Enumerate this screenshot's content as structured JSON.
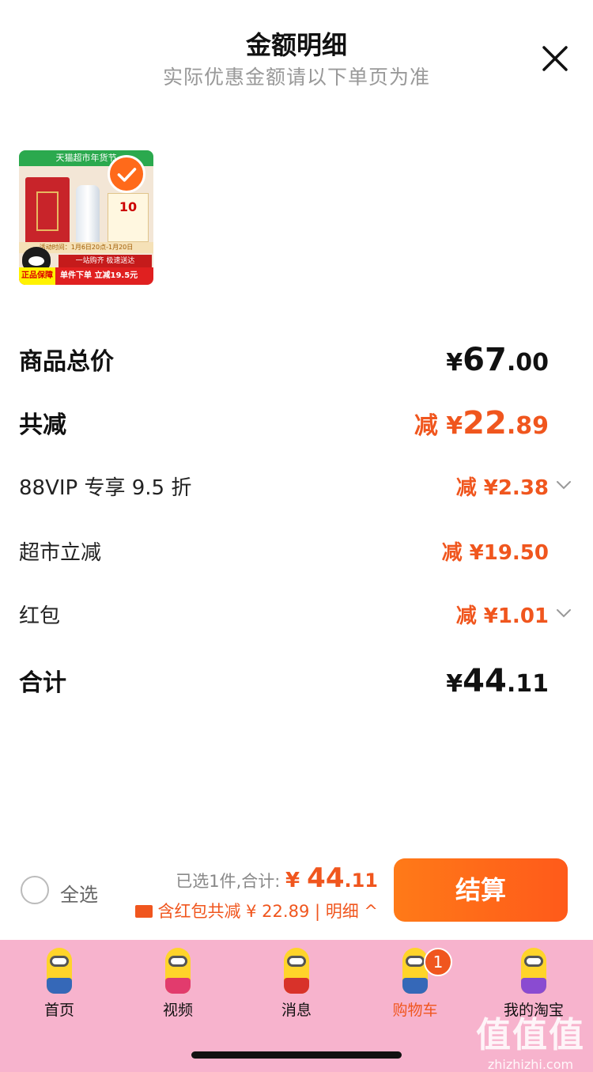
{
  "header": {
    "title": "金额明细",
    "subtitle": "实际优惠金额请以下单页为准"
  },
  "product": {
    "banner": "天猫超市年货节",
    "card_text": "10",
    "strip_text": "活动时间：1月6日20点-1月20日",
    "strip2_text": "一站购齐 极速送达",
    "guarantee_tag": "正品保障",
    "promo_text": "单件下单 立减19.5元"
  },
  "breakdown": {
    "total_price": {
      "label": "商品总价",
      "currency": "¥",
      "int": "67",
      "dec": ".00"
    },
    "total_discount": {
      "label": "共减",
      "prefix": "减",
      "currency": "¥",
      "int": "22",
      "dec": ".89"
    },
    "vip": {
      "label": "88VIP 专享 9.5 折",
      "amount": "减 ¥2.38"
    },
    "supermarket": {
      "label": "超市立减",
      "amount": "减 ¥19.50"
    },
    "red_packet": {
      "label": "红包",
      "amount": "减 ¥1.01"
    },
    "sum": {
      "label": "合计",
      "currency": "¥",
      "int": "44",
      "dec": ".11"
    }
  },
  "bottom_bar": {
    "select_all": "全选",
    "selected_text": "已选1件,合计: ",
    "total_currency": "¥ ",
    "total_int": "44",
    "total_dec": ".11",
    "discount_text": "含红包共减 ¥ 22.89 | 明细 ^",
    "checkout": "结算"
  },
  "tabbar": {
    "tabs": [
      {
        "label": "首页"
      },
      {
        "label": "视频"
      },
      {
        "label": "消息"
      },
      {
        "label": "购物车",
        "badge": "1"
      },
      {
        "label": "我的淘宝"
      }
    ]
  },
  "watermark": {
    "big": "值值值",
    "small": "zhizhizhi.com"
  },
  "colors": {
    "accent": "#f0561e",
    "tabbar_bg": "#f7b3cd",
    "checkout_btn": "#ff6a1a"
  }
}
